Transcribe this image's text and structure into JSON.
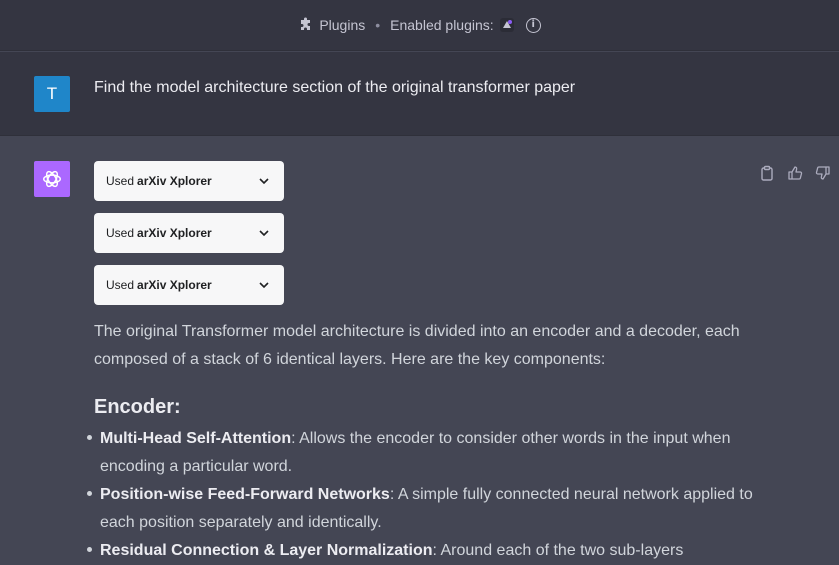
{
  "topbar": {
    "plugins_label": "Plugins",
    "separator": "•",
    "enabled_label": "Enabled plugins:",
    "info_glyph": "i"
  },
  "user_message": {
    "avatar_letter": "T",
    "text": "Find the model architecture section of the original transformer paper"
  },
  "assistant": {
    "plugin_uses": [
      {
        "prefix": "Used",
        "name": "arXiv Xplorer"
      },
      {
        "prefix": "Used",
        "name": "arXiv Xplorer"
      },
      {
        "prefix": "Used",
        "name": "arXiv Xplorer"
      }
    ],
    "intro": "The original Transformer model architecture is divided into an encoder and a decoder, each composed of a stack of 6 identical layers. Here are the key components:",
    "section_heading": "Encoder:",
    "bullets": [
      {
        "term": "Multi-Head Self-Attention",
        "desc": ": Allows the encoder to consider other words in the input when encoding a particular word."
      },
      {
        "term": "Position-wise Feed-Forward Networks",
        "desc": ": A simple fully connected neural network applied to each position separately and identically."
      },
      {
        "term": "Residual Connection & Layer Normalization",
        "desc": ": Around each of the two sub-layers"
      }
    ]
  },
  "colors": {
    "page_bg": "#444654",
    "topbar_bg": "#343541",
    "user_avatar": "#1f86c9",
    "bot_avatar": "#ab68ff",
    "pill_bg": "#f7f7f8"
  },
  "icons": [
    "puzzle-icon",
    "plugin-logo-icon",
    "info-icon",
    "openai-logo-icon",
    "chevron-down-icon",
    "copy-icon",
    "thumbs-up-icon",
    "thumbs-down-icon"
  ]
}
